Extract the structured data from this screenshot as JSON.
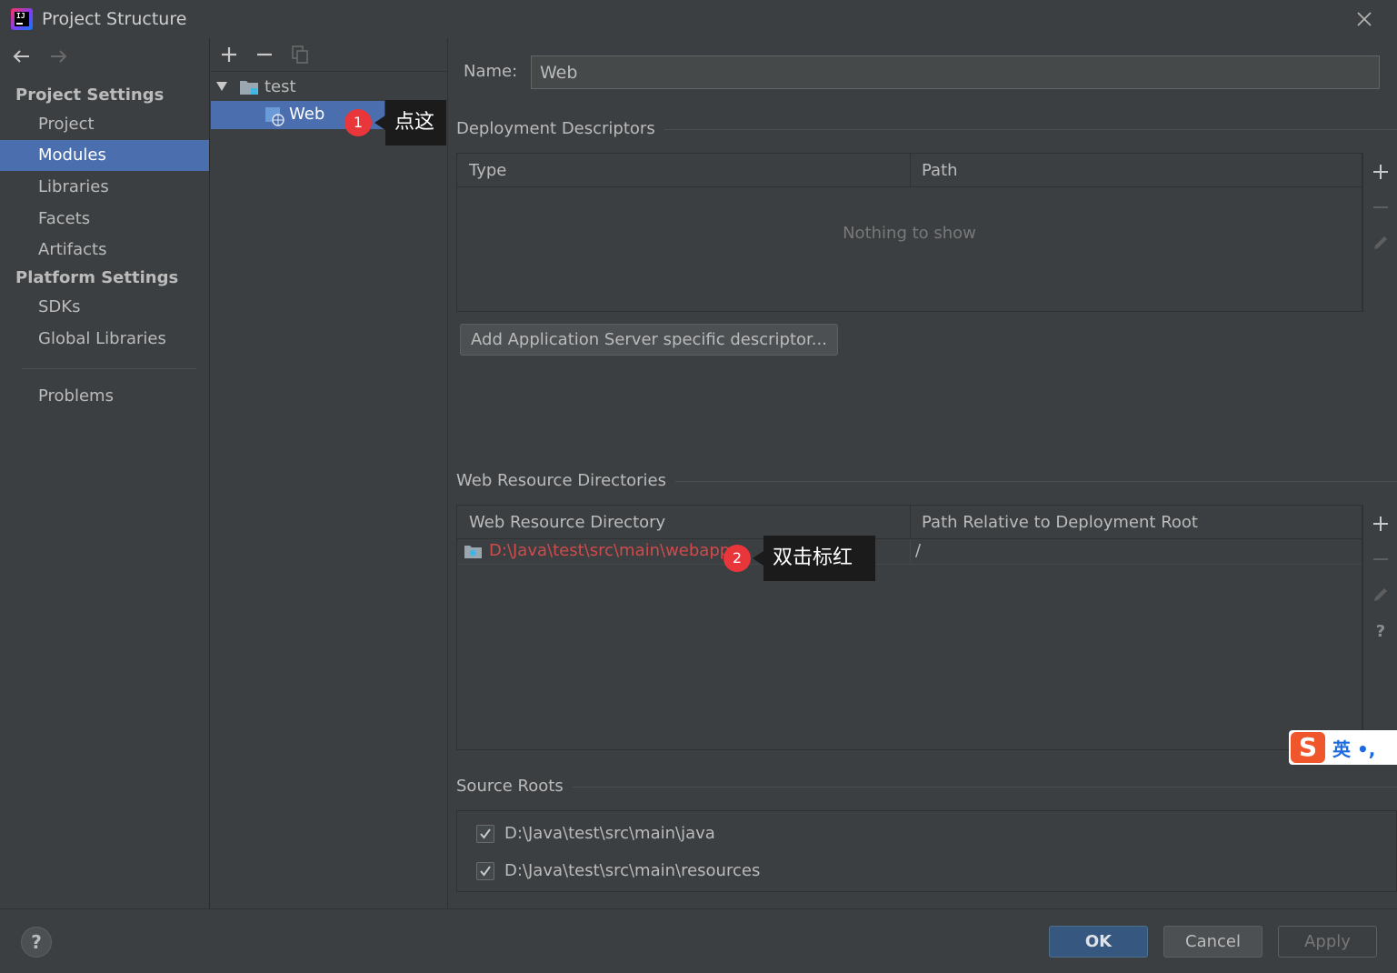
{
  "window": {
    "title": "Project Structure"
  },
  "nav": {
    "project_settings_heading": "Project Settings",
    "platform_settings_heading": "Platform Settings",
    "items": {
      "project": "Project",
      "modules": "Modules",
      "libraries": "Libraries",
      "facets": "Facets",
      "artifacts": "Artifacts",
      "sdks": "SDKs",
      "global_libraries": "Global Libraries",
      "problems": "Problems"
    },
    "selected": "Modules"
  },
  "tree": {
    "root": "test",
    "child": "Web",
    "selected": "Web"
  },
  "annotations": {
    "step1_number": "1",
    "step1_text": "点这",
    "step2_number": "2",
    "step2_text": "双击标红"
  },
  "main": {
    "name_label": "Name:",
    "name_value": "Web",
    "deployment": {
      "title": "Deployment Descriptors",
      "columns": [
        "Type",
        "Path"
      ],
      "empty_text": "Nothing to show",
      "add_button": "Add Application Server specific descriptor..."
    },
    "web_resources": {
      "title": "Web Resource Directories",
      "columns": [
        "Web Resource Directory",
        "Path Relative to Deployment Root"
      ],
      "rows": [
        {
          "directory": "D:\\Java\\test\\src\\main\\webapp",
          "relative_path": "/"
        }
      ]
    },
    "source_roots": {
      "title": "Source Roots",
      "items": [
        {
          "path": "D:\\Java\\test\\src\\main\\java",
          "checked": true
        },
        {
          "path": "D:\\Java\\test\\src\\main\\resources",
          "checked": true
        }
      ]
    }
  },
  "footer": {
    "help": "?",
    "ok": "OK",
    "cancel": "Cancel",
    "apply": "Apply"
  },
  "ime": {
    "logo": "S",
    "text": "英 •,"
  },
  "colors": {
    "accent_selection": "#4b6eaf",
    "background": "#3c3f41",
    "error_path": "#d04b4b",
    "badge": "#e8363a",
    "ok_button": "#365880"
  }
}
